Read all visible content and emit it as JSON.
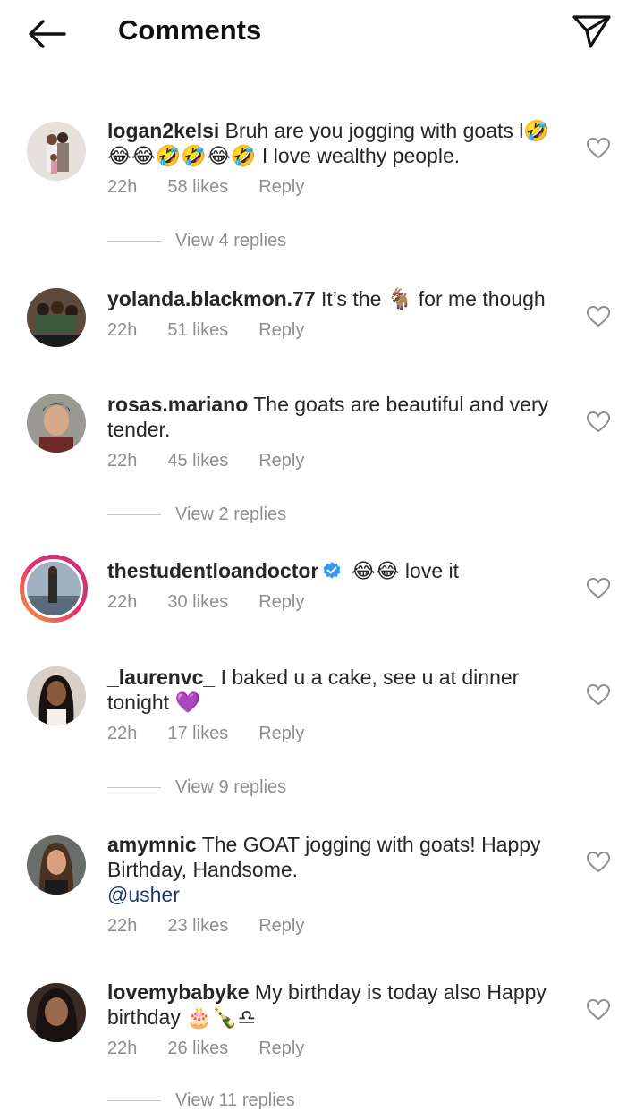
{
  "header": {
    "title": "Comments"
  },
  "comments": [
    {
      "username": "logan2kelsi",
      "text": "Bruh are you jogging with goats l🤣😂😂🤣🤣😂🤣 I love wealthy people.",
      "time": "22h",
      "likes": "58 likes",
      "reply": "Reply",
      "view_replies": "View 4 replies"
    },
    {
      "username": "yolanda.blackmon.77",
      "text": "It’s the 🐐 for me though",
      "time": "22h",
      "likes": "51 likes",
      "reply": "Reply"
    },
    {
      "username": "rosas.mariano",
      "text": "The goats are beautiful and very tender.",
      "time": "22h",
      "likes": "45 likes",
      "reply": "Reply",
      "view_replies": "View 2 replies"
    },
    {
      "username": "thestudentloandoctor",
      "text": "😂😂 love it",
      "time": "22h",
      "likes": "30 likes",
      "reply": "Reply",
      "verified": true
    },
    {
      "username": "_laurenvc_",
      "text": "I baked u a cake, see u at dinner tonight 💜",
      "time": "22h",
      "likes": "17 likes",
      "reply": "Reply",
      "view_replies": "View 9 replies"
    },
    {
      "username": "amymnic",
      "text": "The GOAT jogging with goats! Happy Birthday, Handsome.",
      "mention": "@usher",
      "time": "22h",
      "likes": "23 likes",
      "reply": "Reply"
    },
    {
      "username": "lovemybabyke",
      "text": "My birthday is today also Happy birthday 🎂🍾♎",
      "time": "22h",
      "likes": "26 likes",
      "reply": "Reply",
      "view_replies": "View 11 replies"
    }
  ],
  "colors": {
    "meta": "#8e8e8e",
    "mention": "#1b3a6b",
    "verified": "#3897f0"
  },
  "icons": [
    "back-arrow-icon",
    "send-icon",
    "heart-icon",
    "verified-badge-icon"
  ]
}
